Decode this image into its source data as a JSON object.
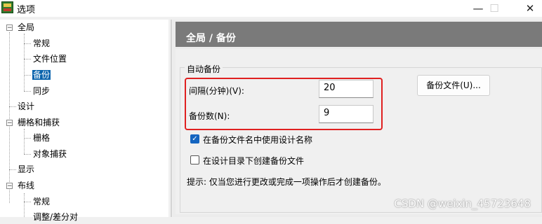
{
  "window": {
    "title": "选项",
    "minimize": "—",
    "maximize": "☐",
    "close": "✕"
  },
  "tree": {
    "global": "全局",
    "general": "常规",
    "file_locations": "文件位置",
    "backup": "备份",
    "sync": "同步",
    "design": "设计",
    "grid_snap": "栅格和捕获",
    "grid": "栅格",
    "object_snap": "对象捕获",
    "display": "显示",
    "routing": "布线",
    "routing_general": "常规",
    "routing_adjust": "调整/差分对"
  },
  "header": {
    "title": "全局 / 备份"
  },
  "auto_backup": {
    "group_label": "自动备份",
    "interval_label": "间隔(分钟)(V):",
    "interval_value": "20",
    "count_label": "备份数(N):",
    "count_value": "9",
    "backup_files_button": "备份文件(U)...",
    "use_design_name_label": "在备份文件名中使用设计名称",
    "use_design_name_checked": true,
    "create_in_design_dir_label": "在设计目录下创建备份文件",
    "create_in_design_dir_checked": false,
    "hint": "提示:  仅当您进行更改或完成一项操作后才创建备份。"
  },
  "watermark": "CSDN @weixin_45723648",
  "colors": {
    "header_bg": "#7a7a7a",
    "selection": "#0a64ad",
    "highlight_box": "#e02020",
    "checkbox_on": "#1565c0"
  }
}
